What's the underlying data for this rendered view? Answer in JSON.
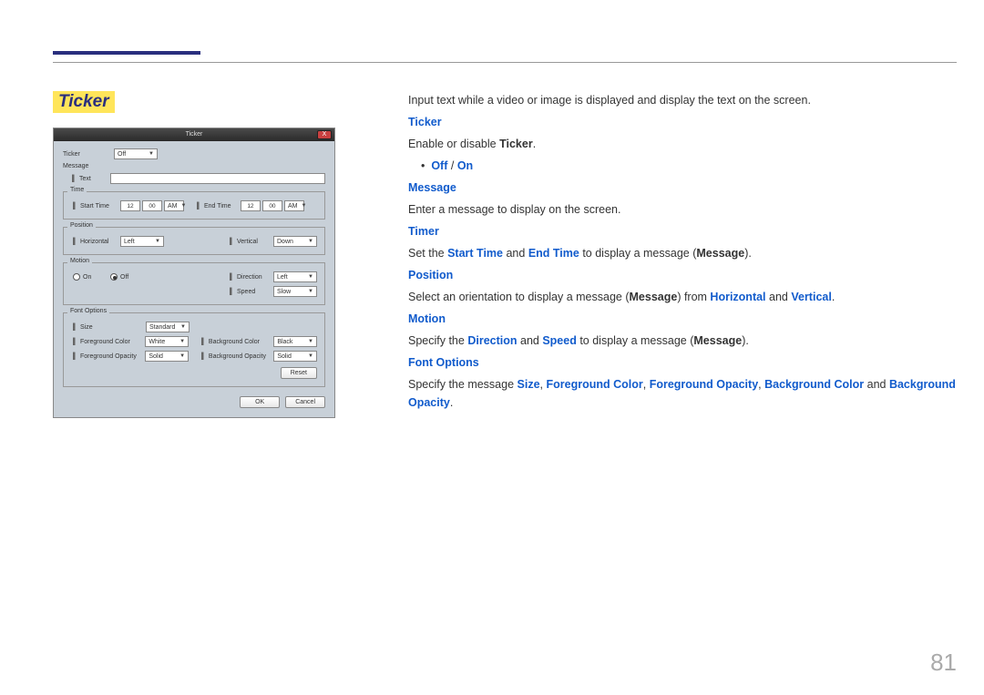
{
  "pageNumber": "81",
  "heading": "Ticker",
  "dialog": {
    "title": "Ticker",
    "close": "X",
    "tickerLabel": "Ticker",
    "tickerValue": "Off",
    "messageLabel": "Message",
    "textLabel": "Text",
    "time": {
      "title": "Time",
      "startLabel": "Start Time",
      "endLabel": "End Time",
      "hh1": "12",
      "mm1": "00",
      "ap1": "AM",
      "hh2": "12",
      "mm2": "00",
      "ap2": "AM"
    },
    "position": {
      "title": "Position",
      "hLabel": "Horizontal",
      "hValue": "Left",
      "vLabel": "Vertical",
      "vValue": "Down"
    },
    "motion": {
      "title": "Motion",
      "on": "On",
      "off": "Off",
      "dirLabel": "Direction",
      "dirValue": "Left",
      "spdLabel": "Speed",
      "spdValue": "Slow"
    },
    "font": {
      "title": "Font Options",
      "sizeLabel": "Size",
      "sizeValue": "Standard",
      "fgcLabel": "Foreground Color",
      "fgcValue": "White",
      "bgcLabel": "Background Color",
      "bgcValue": "Black",
      "fgoLabel": "Foreground Opacity",
      "fgoValue": "Solid",
      "bgoLabel": "Background Opacity",
      "bgoValue": "Solid",
      "reset": "Reset"
    },
    "ok": "OK",
    "cancel": "Cancel"
  },
  "doc": {
    "intro": "Input text while a video or image is displayed and display the text on the screen.",
    "ticker": {
      "hd": "Ticker",
      "p1a": "Enable or disable ",
      "p1b": "Ticker",
      "p1c": ".",
      "bullet_off": "Off",
      "bullet_sep": " / ",
      "bullet_on": "On"
    },
    "message": {
      "hd": "Message",
      "p": "Enter a message to display on the screen."
    },
    "timer": {
      "hd": "Timer",
      "a": "Set the ",
      "b": "Start Time",
      "c": " and ",
      "d": "End Time",
      "e": " to display a message (",
      "f": "Message",
      "g": ")."
    },
    "position": {
      "hd": "Position",
      "a": "Select an orientation to display a message (",
      "b": "Message",
      "c": ") from ",
      "d": "Horizontal",
      "e": " and ",
      "f": "Vertical",
      "g": "."
    },
    "motion": {
      "hd": "Motion",
      "a": "Specify the ",
      "b": "Direction",
      "c": " and ",
      "d": "Speed",
      "e": " to display a message (",
      "f": "Message",
      "g": ")."
    },
    "fontopt": {
      "hd": "Font Options",
      "a": "Specify the message ",
      "b": "Size",
      "c": ", ",
      "d": "Foreground Color",
      "e": ", ",
      "f": "Foreground Opacity",
      "g": ", ",
      "h": "Background Color",
      "i": " and ",
      "j": "Background Opacity",
      "k": "."
    }
  }
}
